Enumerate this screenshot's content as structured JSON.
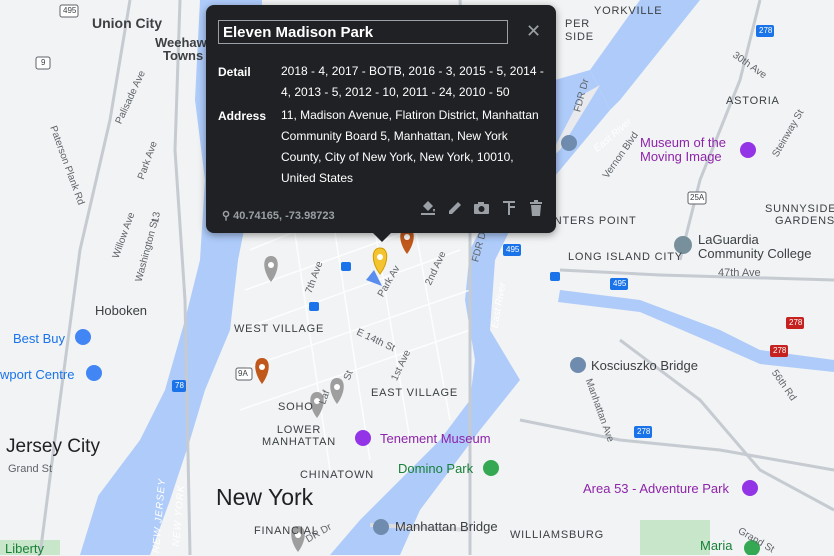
{
  "popup": {
    "title": "Eleven Madison Park",
    "detail_label": "Detail",
    "detail_value": "2018 - 4, 2017 - BOTB, 2016 - 3, 2015 - 5, 2014 - 4, 2013 - 5, 2012 - 10, 2011 - 24, 2010 - 50",
    "address_label": "Address",
    "address_value": "11, Madison Avenue, Flatiron District, Manhattan Community Board 5, Manhattan, New York County, City of New York, New York, 10010, United States",
    "coordinates": "40.74165, -73.98723",
    "close_icon": "close-icon",
    "tools": [
      "paint-bucket-icon",
      "pencil-icon",
      "camera-icon",
      "route-icon",
      "trash-icon"
    ]
  },
  "map": {
    "colors": {
      "water": "#aecbfa",
      "land": "#f1f3f4",
      "park": "#c8e6c9",
      "road": "#ffffff",
      "highway": "#dadce0",
      "marker_yellow": "#f4c430",
      "marker_orange": "#c1581b",
      "marker_gray": "#9e9e9e"
    },
    "labels": {
      "union_city": "Union City",
      "weehawken": "Weehaw",
      "township": "Towns",
      "yorkville": "YORKVILLE",
      "per_side": "PER",
      "side": "SIDE",
      "astoria": "ASTORIA",
      "ave30": "30th Ave",
      "steinway": "Steinway St",
      "museum_mi": "Museum of the\nMoving Image",
      "vernon": "Vernon Blvd",
      "east_river_n": "East River",
      "sunnyside": "SUNNYSIDE",
      "gardens": "GARDENS",
      "hunters_point": "UNTERS POINT",
      "lic": "LONG ISLAND CITY",
      "laguardia": "LaGuardia\nCommunity College",
      "ave47": "47th Ave",
      "hoboken": "Hoboken",
      "west_village": "WEST VILLAGE",
      "best_buy": "Best Buy",
      "newport": "wport Centre",
      "east_village": "EAST VILLAGE",
      "soho": "SOHO",
      "lower_manhattan": "LOWER\nMANHATTAN",
      "tenement": "Tenement Museum",
      "domino": "Domino Park",
      "kosciuszko": "Kosciuszko Bridge",
      "jersey_city": "Jersey City",
      "grand_st": "Grand St",
      "chinatown": "CHINATOWN",
      "new_york": "New York",
      "area53": "Area 53 - Adventure Park",
      "financial": "FINANCIAL",
      "manhattan_bridge": "Manhattan Bridge",
      "williamsburg": "WILLIAMSBURG",
      "maria": "Maria",
      "liberty": "Liberty",
      "new_jersey": "NEW JERSEY",
      "new_york_v": "NEW YORK",
      "east_river_s": "East River",
      "street_7th": "7th Ave",
      "street_14th": "E 14th St",
      "street_1st": "1st Ave",
      "street_2nd": "2nd Ave",
      "street_park": "Park Av",
      "street_laf": "Laf",
      "street_st": "St",
      "street_palisade": "Palisade Ave",
      "street_paterson": "Paterson Plank Rd",
      "street_parkave": "Park Ave",
      "street_willow": "Willow Ave",
      "street_washington": "Washington St",
      "street_56th": "56th Rd",
      "street_manhattan": "Manhattan Ave",
      "street_grand": "Grand St",
      "fdr": "FDR Dr",
      "fdr2": "FDR Dr",
      "fdr3": "DR Dr",
      "shield_495": "495",
      "shield_495b": "495",
      "shield_495c": "495",
      "shield_278": "278",
      "shield_278b": "278",
      "shield_278c": "278",
      "shield_278d": "278",
      "shield_9": "9",
      "shield_9a": "9A",
      "shield_78": "78",
      "shield_25a": "25A",
      "st_13": "13"
    }
  }
}
